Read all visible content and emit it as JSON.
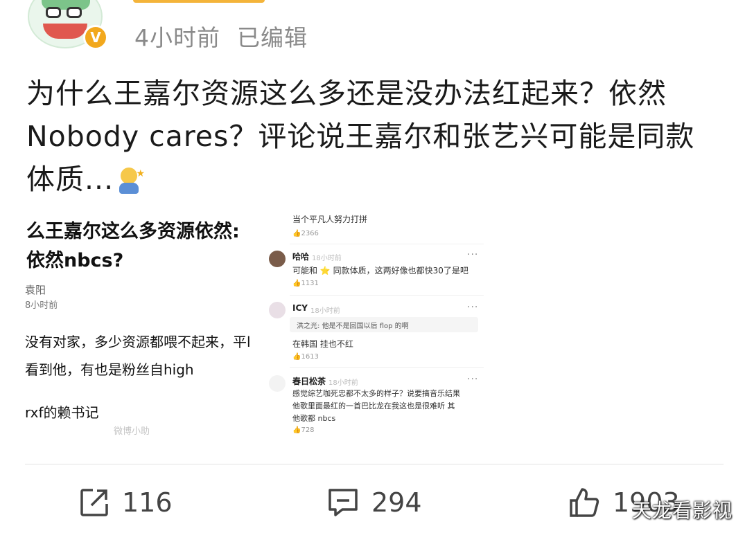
{
  "post": {
    "time": "4小时前",
    "edited": "已编辑",
    "verified_badge": "V",
    "text_line1": "为什么王嘉尔资源这么多还是没办法红起来？依然",
    "text_line2": "Nobody cares？评论说王嘉尔和张艺兴可能是同款",
    "text_line3": "体质..."
  },
  "left_image": {
    "title_line1": "么王嘉尔这么多资源依然:",
    "title_line2": "依然nbcs?",
    "author": "袁阳",
    "time": "8小时前",
    "body_line1": "没有对家，多少资源都喂不起来，平l",
    "body_line2": "看到他，有也是粉丝自high",
    "signature": "rxf的赖书记",
    "watermark": "微博小助"
  },
  "right_image": {
    "top_comment": "当个平凡人努力打拼",
    "top_likes": "2366",
    "comments": [
      {
        "name": "哈哈",
        "time": "18小时前",
        "text": "可能和 ⭐ 同款体质，这两好像也都快30了是吧",
        "likes": "1131"
      },
      {
        "name": "ICY",
        "time": "18小时前",
        "quote": "洪之光: 他是不是回国以后 flop 的啊",
        "text": "在韩国 挂也不红",
        "likes": "1613"
      },
      {
        "name": "春日松茶",
        "time": "18小时前",
        "text_line1": "感觉综艺咖死忠都不太多的样子？说要搞音乐结果",
        "text_line2": "他歌里面最红的一首巴比龙在我这也是很难听 其",
        "text_line3": "他歌都 nbcs",
        "likes": "728"
      }
    ],
    "more": "···"
  },
  "actions": {
    "repost_count": "116",
    "comment_count": "294",
    "like_count": "1903"
  },
  "watermark": "天龙看影视",
  "colors": {
    "badge": "#f2a81d",
    "meta_gray": "#8a8a8a",
    "icon": "#444444"
  }
}
